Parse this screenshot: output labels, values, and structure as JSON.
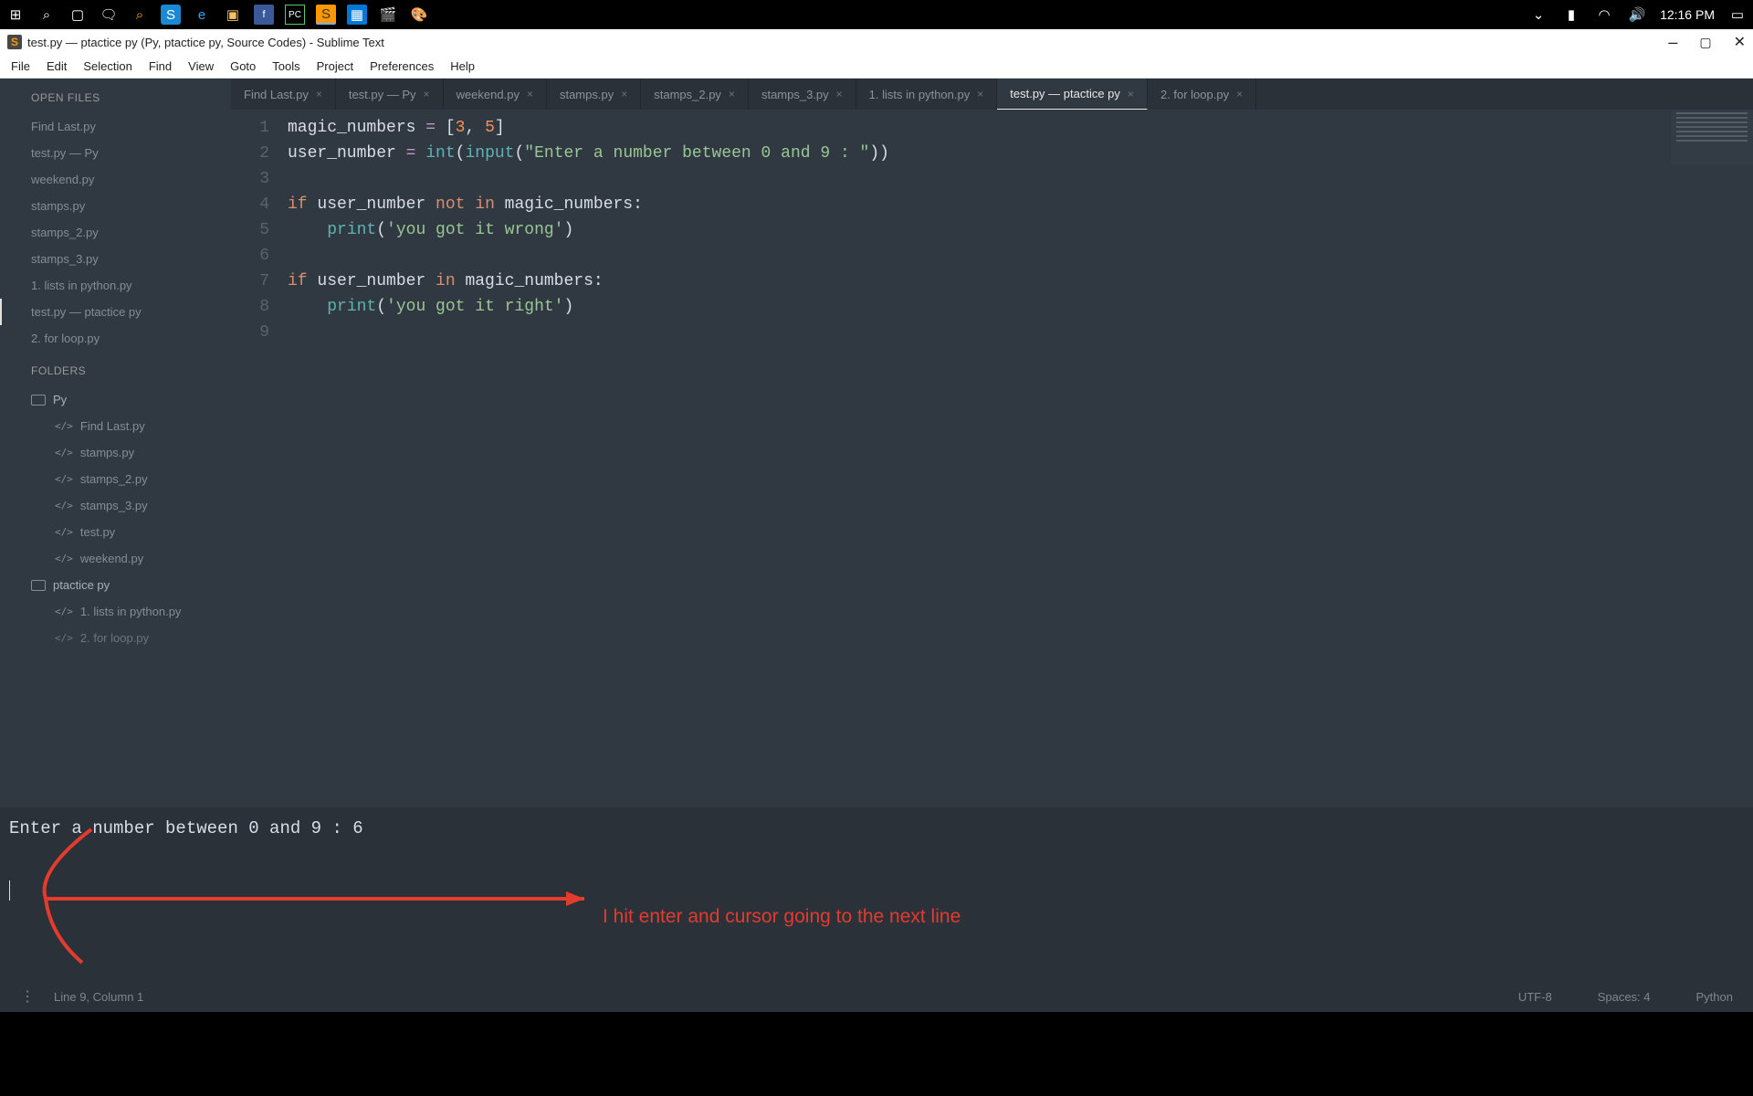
{
  "taskbar": {
    "clock": "12:16 PM"
  },
  "title": "test.py — ptactice py (Py, ptactice py, Source Codes) - Sublime Text",
  "menu": [
    "File",
    "Edit",
    "Selection",
    "Find",
    "View",
    "Goto",
    "Tools",
    "Project",
    "Preferences",
    "Help"
  ],
  "sidebar": {
    "open_files_label": "OPEN FILES",
    "open_files": [
      "Find Last.py",
      "test.py — Py",
      "weekend.py",
      "stamps.py",
      "stamps_2.py",
      "stamps_3.py",
      "1. lists in python.py",
      "test.py — ptactice py",
      "2. for loop.py"
    ],
    "active_open_index": 7,
    "folders_label": "FOLDERS",
    "folder1": {
      "name": "Py",
      "files": [
        "Find Last.py",
        "stamps.py",
        "stamps_2.py",
        "stamps_3.py",
        "test.py",
        "weekend.py"
      ]
    },
    "folder2": {
      "name": "ptactice py",
      "files": [
        "1. lists in python.py",
        "2. for loop.py"
      ]
    }
  },
  "tabs": [
    "Find Last.py",
    "test.py — Py",
    "weekend.py",
    "stamps.py",
    "stamps_2.py",
    "stamps_3.py",
    "1. lists in python.py",
    "test.py — ptactice py",
    "2. for loop.py"
  ],
  "active_tab_index": 7,
  "code_lines": [
    1,
    2,
    3,
    4,
    5,
    6,
    7,
    8,
    9
  ],
  "code": {
    "l1": {
      "a": "magic_numbers ",
      "op": "=",
      "b": " [",
      "n1": "3",
      "c": ", ",
      "n2": "5",
      "d": "]"
    },
    "l2": {
      "a": "user_number ",
      "op": "=",
      "sp": " ",
      "f1": "int",
      "p1": "(",
      "f2": "input",
      "p2": "(",
      "s": "\"Enter a number between 0 and 9 : \"",
      "p3": "))"
    },
    "l4": {
      "k1": "if",
      "a": " user_number ",
      "k2": "not",
      "sp": " ",
      "k3": "in",
      "b": " magic_numbers:"
    },
    "l5": {
      "ind": "    ",
      "f": "print",
      "p1": "(",
      "s": "'you got it wrong'",
      "p2": ")"
    },
    "l7": {
      "k1": "if",
      "a": " user_number ",
      "k2": "in",
      "b": " magic_numbers:"
    },
    "l8": {
      "ind": "    ",
      "f": "print",
      "p1": "(",
      "s": "'you got it right'",
      "p2": ")"
    }
  },
  "console_text": "Enter a number between 0 and 9 : 6",
  "annotation_text": "I hit enter and cursor going to the next line",
  "statusbar": {
    "position": "Line 9, Column 1",
    "encoding": "UTF-8",
    "indent": "Spaces: 4",
    "syntax": "Python"
  }
}
